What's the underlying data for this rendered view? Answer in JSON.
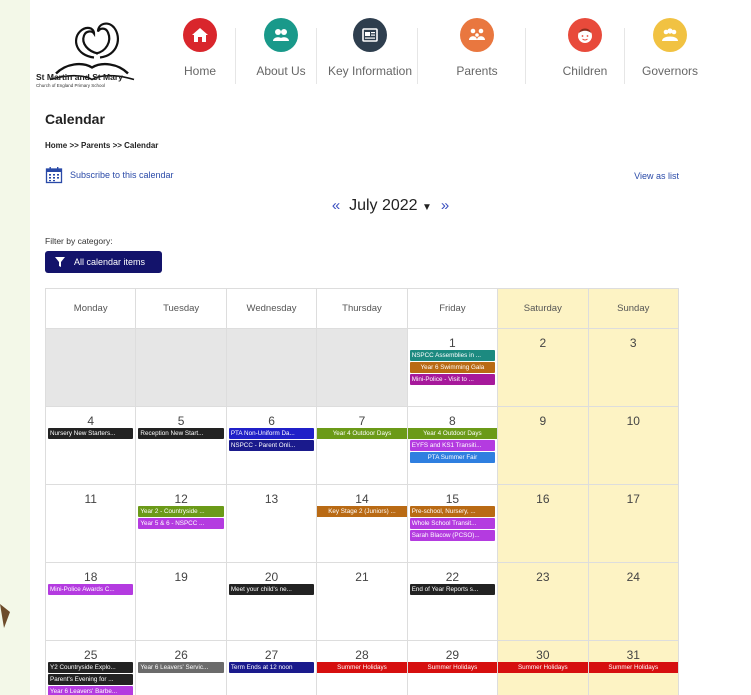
{
  "school": {
    "name": "St Martin and St Mary",
    "subtitle": "Church of England Primary School"
  },
  "nav": [
    {
      "label": "Home",
      "color": "#d9262c",
      "icon": "home-icon"
    },
    {
      "label": "About Us",
      "color": "#19998a",
      "icon": "people-icon"
    },
    {
      "label": "Key Information",
      "color": "#2e3e4e",
      "icon": "document-icon"
    },
    {
      "label": "Parents",
      "color": "#e9773f",
      "icon": "family-icon"
    },
    {
      "label": "Children",
      "color": "#e84a3b",
      "icon": "child-face-icon"
    },
    {
      "label": "Governors",
      "color": "#f1c242",
      "icon": "group-icon"
    }
  ],
  "page": {
    "title": "Calendar",
    "breadcrumb": "Home >> Parents >> Calendar",
    "subscribe": "Subscribe to this calendar",
    "view_list": "View as list",
    "month": "July 2022",
    "prev": "«",
    "next": "»",
    "filter_label": "Filter by category:",
    "filter_button": "All calendar items"
  },
  "days": [
    "Monday",
    "Tuesday",
    "Wednesday",
    "Thursday",
    "Friday",
    "Saturday",
    "Sunday"
  ],
  "colors": {
    "teal": "#1c8a80",
    "orange": "#b96a14",
    "magenta": "#a6199b",
    "black": "#222222",
    "blue": "#2020c8",
    "navy": "#1a1a8c",
    "green": "#6b9a18",
    "violet": "#b43be0",
    "lightblue": "#2f7fe0",
    "grey": "#6b6b6b",
    "red": "#d60f0f",
    "weekend": "#fdf3c4"
  },
  "weeks": [
    [
      {
        "day": "",
        "empty": true,
        "events": []
      },
      {
        "day": "",
        "empty": true,
        "events": []
      },
      {
        "day": "",
        "empty": true,
        "events": []
      },
      {
        "day": "",
        "empty": true,
        "events": []
      },
      {
        "day": "1",
        "events": [
          {
            "t": "NSPCC Assemblies in ...",
            "c": "teal"
          },
          {
            "t": "Year 6 Swimming Gala",
            "c": "orange",
            "center": true
          },
          {
            "t": "Mini-Police - Visit to ...",
            "c": "magenta"
          }
        ]
      },
      {
        "day": "2",
        "events": []
      },
      {
        "day": "3",
        "events": []
      }
    ],
    [
      {
        "day": "4",
        "events": [
          {
            "t": "Nursery New Starters...",
            "c": "black"
          }
        ]
      },
      {
        "day": "5",
        "events": [
          {
            "t": "Reception New Start...",
            "c": "black"
          }
        ]
      },
      {
        "day": "6",
        "events": [
          {
            "t": "PTA Non-Uniform Da...",
            "c": "blue"
          },
          {
            "t": "NSPCC - Parent Onli...",
            "c": "navy"
          }
        ]
      },
      {
        "day": "7",
        "events": [
          {
            "t": "Year 4 Outdoor Days",
            "c": "green",
            "full": true
          }
        ]
      },
      {
        "day": "8",
        "events": [
          {
            "t": "Year 4 Outdoor Days",
            "c": "green",
            "full": true
          },
          {
            "t": "EYFS and KS1 Transiti...",
            "c": "violet"
          },
          {
            "t": "PTA Summer Fair",
            "c": "lightblue",
            "center": true
          }
        ]
      },
      {
        "day": "9",
        "events": []
      },
      {
        "day": "10",
        "events": []
      }
    ],
    [
      {
        "day": "11",
        "events": []
      },
      {
        "day": "12",
        "events": [
          {
            "t": "Year 2 - Countryside ...",
            "c": "green"
          },
          {
            "t": "Year 5 & 6 - NSPCC ...",
            "c": "violet"
          }
        ]
      },
      {
        "day": "13",
        "events": []
      },
      {
        "day": "14",
        "events": [
          {
            "t": "Key Stage 2 (Juniors) ...",
            "c": "orange",
            "full": true
          }
        ]
      },
      {
        "day": "15",
        "events": [
          {
            "t": "Pre-school, Nursery, ...",
            "c": "orange"
          },
          {
            "t": "Whole School Transit...",
            "c": "violet"
          },
          {
            "t": "Sarah Blacow (PCSO)...",
            "c": "violet"
          }
        ]
      },
      {
        "day": "16",
        "events": []
      },
      {
        "day": "17",
        "events": []
      }
    ],
    [
      {
        "day": "18",
        "events": [
          {
            "t": "Mini-Police Awards C...",
            "c": "violet"
          }
        ]
      },
      {
        "day": "19",
        "events": []
      },
      {
        "day": "20",
        "events": [
          {
            "t": "Meet your child's ne...",
            "c": "black"
          }
        ]
      },
      {
        "day": "21",
        "events": []
      },
      {
        "day": "22",
        "events": [
          {
            "t": "End of Year Reports s...",
            "c": "black"
          }
        ]
      },
      {
        "day": "23",
        "events": []
      },
      {
        "day": "24",
        "events": []
      }
    ],
    [
      {
        "day": "25",
        "events": [
          {
            "t": "Y2 Countryside Explo...",
            "c": "black"
          },
          {
            "t": "Parent's Evening for ...",
            "c": "black"
          },
          {
            "t": "Year 6 Leavers' Barbe...",
            "c": "violet"
          }
        ]
      },
      {
        "day": "26",
        "events": [
          {
            "t": "Year 6 Leavers' Servic...",
            "c": "grey"
          }
        ]
      },
      {
        "day": "27",
        "events": [
          {
            "t": "Term Ends at 12 noon",
            "c": "navy"
          }
        ]
      },
      {
        "day": "28",
        "events": [
          {
            "t": "Summer Holidays",
            "c": "red",
            "full": true
          }
        ]
      },
      {
        "day": "29",
        "events": [
          {
            "t": "Summer Holidays",
            "c": "red",
            "full": true
          }
        ]
      },
      {
        "day": "30",
        "events": [
          {
            "t": "Summer Holidays",
            "c": "red",
            "full": true
          }
        ]
      },
      {
        "day": "31",
        "events": [
          {
            "t": "Summer Holidays",
            "c": "red",
            "full": true
          }
        ]
      }
    ]
  ]
}
